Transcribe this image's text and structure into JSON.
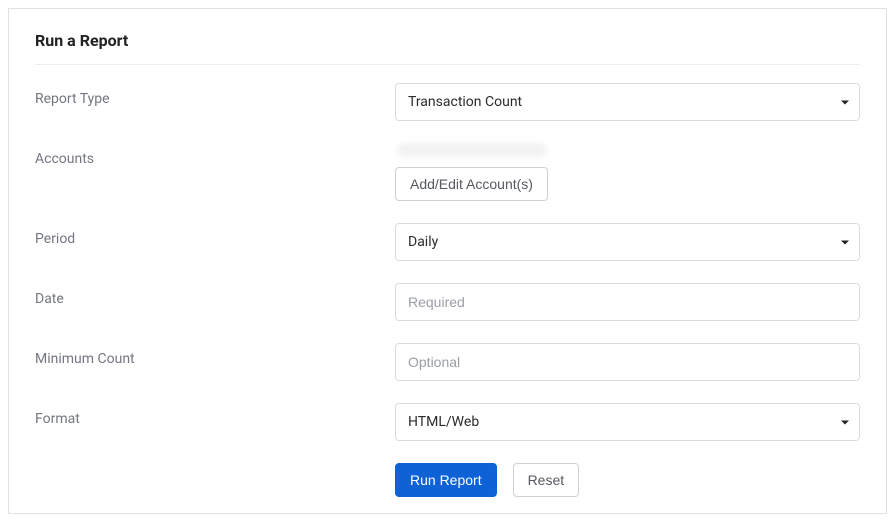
{
  "panel": {
    "title": "Run a Report"
  },
  "labels": {
    "report_type": "Report Type",
    "accounts": "Accounts",
    "period": "Period",
    "date": "Date",
    "minimum_count": "Minimum Count",
    "format": "Format"
  },
  "fields": {
    "report_type": {
      "value": "Transaction Count"
    },
    "accounts": {
      "edit_button": "Add/Edit Account(s)"
    },
    "period": {
      "value": "Daily"
    },
    "date": {
      "value": "",
      "placeholder": "Required"
    },
    "minimum_count": {
      "value": "",
      "placeholder": "Optional"
    },
    "format": {
      "value": "HTML/Web"
    }
  },
  "actions": {
    "run_report": "Run Report",
    "reset": "Reset"
  }
}
